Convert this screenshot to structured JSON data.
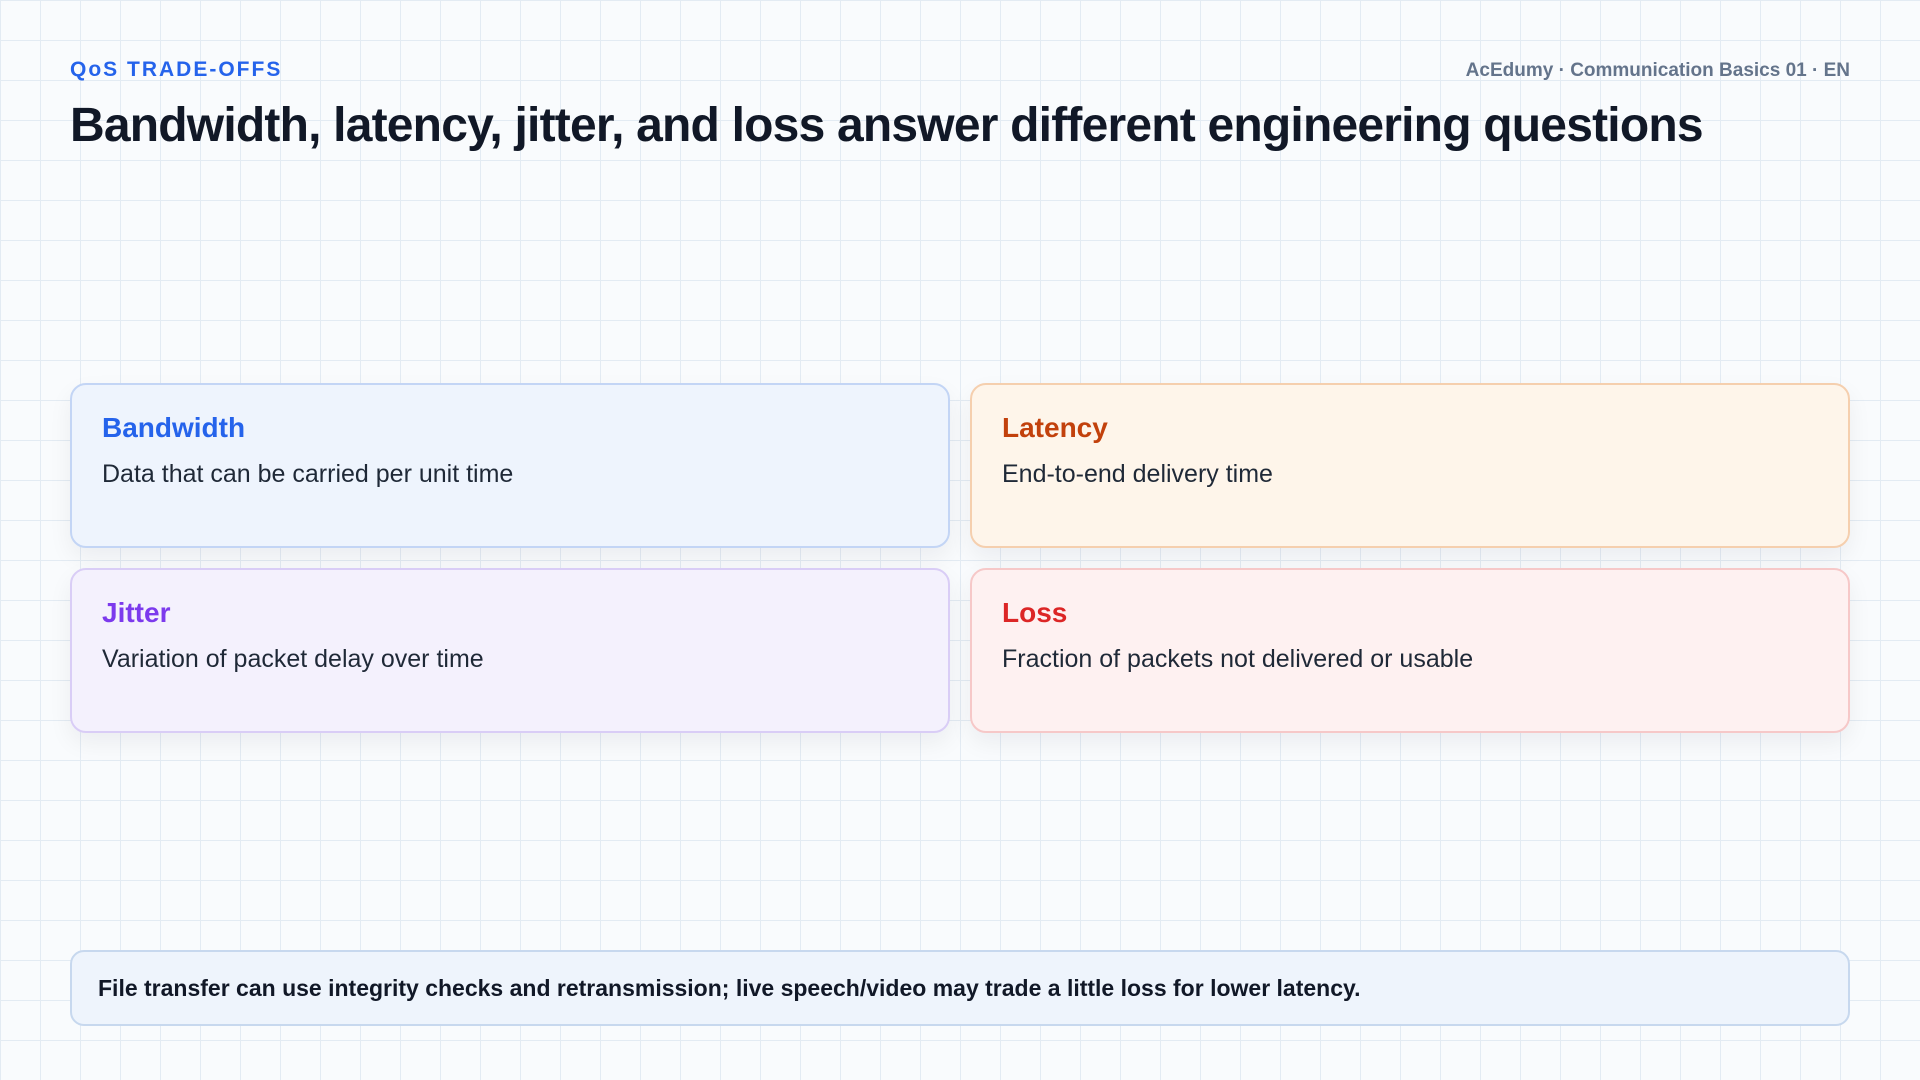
{
  "header": {
    "kicker": "QoS TRADE-OFFS",
    "course": "AcEdumy · Communication Basics 01 · EN",
    "title": "Bandwidth, latency, jitter, and loss answer different engineering questions"
  },
  "cards": [
    {
      "title": "Bandwidth",
      "text": "Data that can be carried per unit time",
      "title_color": "#2563eb",
      "background": "#eef4fd",
      "border": "#c3d5f5"
    },
    {
      "title": "Latency",
      "text": "End-to-end delivery time",
      "title_color": "#c2410c",
      "background": "#fef5ea",
      "border": "#f5cfae"
    },
    {
      "title": "Jitter",
      "text": "Variation of packet delay over time",
      "title_color": "#7c3aed",
      "background": "#f4f1fd",
      "border": "#d9cdf6"
    },
    {
      "title": "Loss",
      "text": "Fraction of packets not delivered or usable",
      "title_color": "#dc2626",
      "background": "#fef1f1",
      "border": "#f6c8c8"
    }
  ],
  "footer": {
    "note": "File transfer can use integrity checks and retransmission; live speech/video may trade a little loss for lower latency."
  }
}
